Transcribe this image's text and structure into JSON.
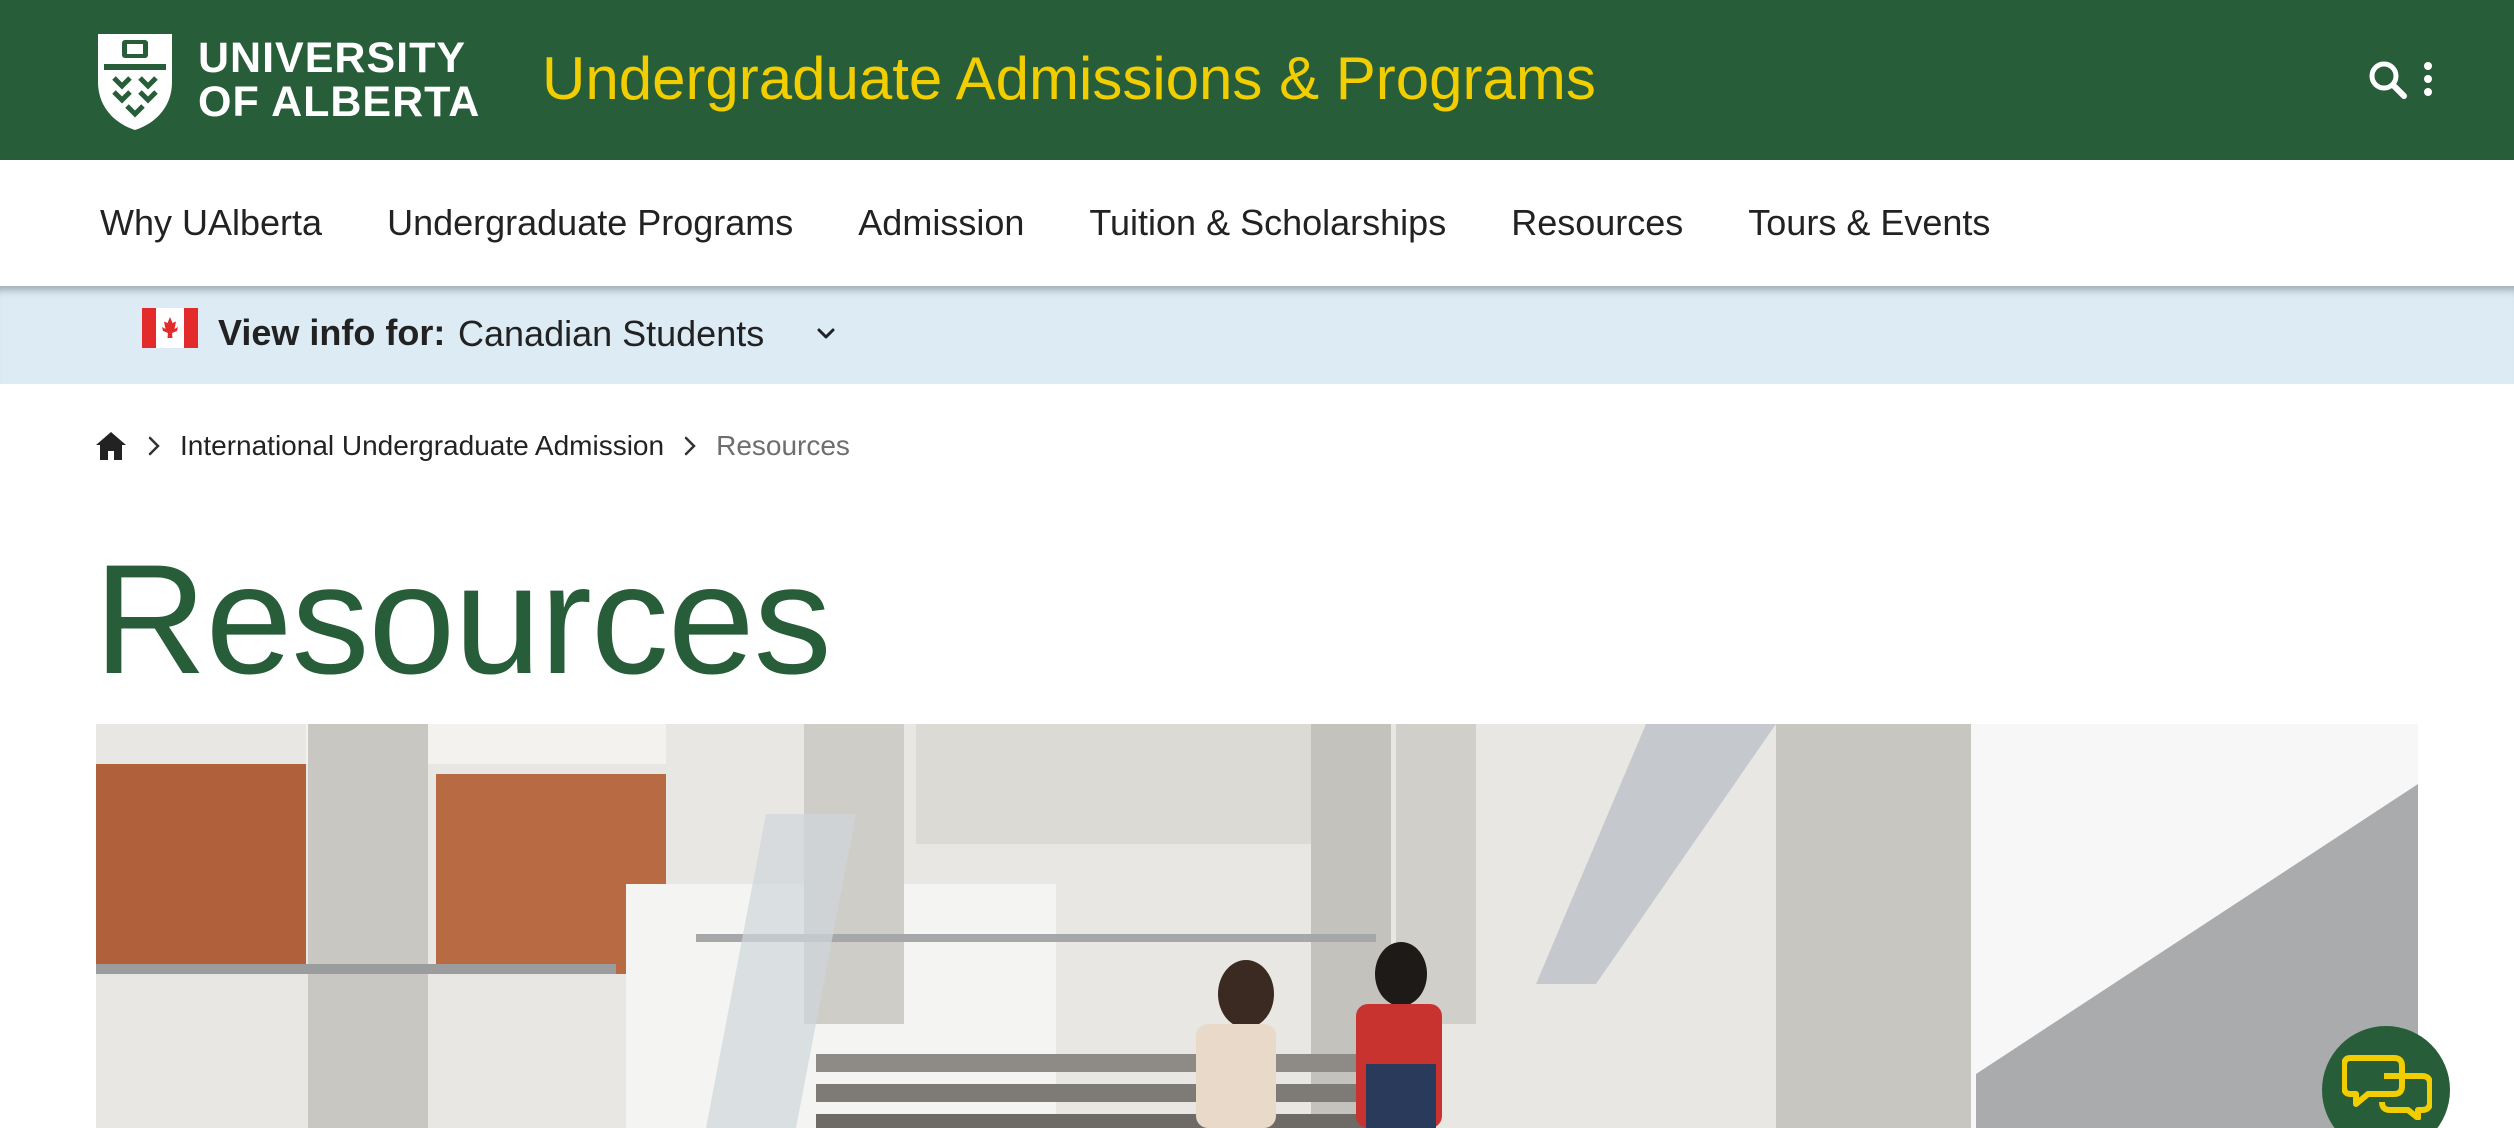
{
  "header": {
    "logo": {
      "line1": "UNIVERSITY",
      "line2": "OF ALBERTA",
      "icon": "shield-crest-icon"
    },
    "site_title": "Undergraduate Admissions & Programs",
    "search_icon": "search-icon",
    "more_icon": "vertical-ellipsis-icon"
  },
  "nav": {
    "items": [
      {
        "label": "Why UAlberta"
      },
      {
        "label": "Undergraduate Programs"
      },
      {
        "label": "Admission"
      },
      {
        "label": "Tuition & Scholarships"
      },
      {
        "label": "Resources"
      },
      {
        "label": "Tours & Events"
      }
    ]
  },
  "view_info": {
    "flag_icon": "canada-flag-icon",
    "label": "View info for:",
    "selected": "Canadian Students",
    "chevron_icon": "chevron-down-icon"
  },
  "breadcrumb": {
    "home_icon": "home-icon",
    "items": [
      {
        "label": "International Undergraduate Admission"
      }
    ],
    "current": "Resources"
  },
  "page": {
    "title": "Resources",
    "hero": "students-on-stairs-photo"
  },
  "chat": {
    "icon": "chat-bubbles-icon"
  },
  "colors": {
    "brand_green": "#275d38",
    "brand_gold": "#f2cd00",
    "info_bar": "#dcebf4"
  }
}
